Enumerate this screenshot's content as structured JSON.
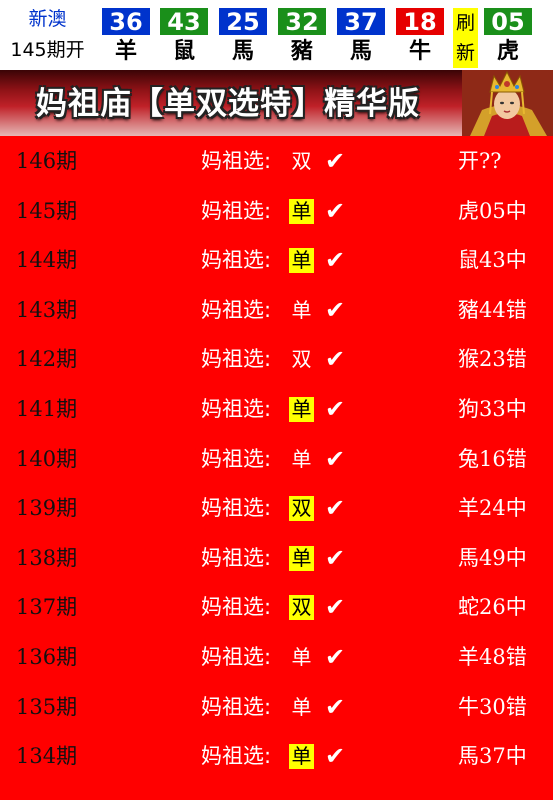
{
  "header": {
    "lottery_name": "新澳",
    "period_label": "145期开",
    "refresh_label": [
      "刷",
      "新"
    ],
    "balls": [
      {
        "number": "36",
        "zodiac": "羊",
        "color": "#0033cc"
      },
      {
        "number": "43",
        "zodiac": "鼠",
        "color": "#1a8f1a"
      },
      {
        "number": "25",
        "zodiac": "馬",
        "color": "#0033cc"
      },
      {
        "number": "32",
        "zodiac": "豬",
        "color": "#1a8f1a"
      },
      {
        "number": "37",
        "zodiac": "馬",
        "color": "#0033cc"
      },
      {
        "number": "18",
        "zodiac": "牛",
        "color": "#e60000"
      },
      {
        "number": "05",
        "zodiac": "虎",
        "color": "#1a8f1a"
      }
    ]
  },
  "banner": {
    "title": "妈祖庙【单双选特】精华版"
  },
  "records": [
    {
      "period": "146期",
      "label": "妈祖选:",
      "pick": "双",
      "highlight": false,
      "tick": "✔",
      "result": "开??"
    },
    {
      "period": "145期",
      "label": "妈祖选:",
      "pick": "单",
      "highlight": true,
      "tick": "✔",
      "result": "虎05中"
    },
    {
      "period": "144期",
      "label": "妈祖选:",
      "pick": "单",
      "highlight": true,
      "tick": "✔",
      "result": "鼠43中"
    },
    {
      "period": "143期",
      "label": "妈祖选:",
      "pick": "单",
      "highlight": false,
      "tick": "✔",
      "result": "豬44错"
    },
    {
      "period": "142期",
      "label": "妈祖选:",
      "pick": "双",
      "highlight": false,
      "tick": "✔",
      "result": "猴23错"
    },
    {
      "period": "141期",
      "label": "妈祖选:",
      "pick": "单",
      "highlight": true,
      "tick": "✔",
      "result": "狗33中"
    },
    {
      "period": "140期",
      "label": "妈祖选:",
      "pick": "单",
      "highlight": false,
      "tick": "✔",
      "result": "兔16错"
    },
    {
      "period": "139期",
      "label": "妈祖选:",
      "pick": "双",
      "highlight": true,
      "tick": "✔",
      "result": "羊24中"
    },
    {
      "period": "138期",
      "label": "妈祖选:",
      "pick": "单",
      "highlight": true,
      "tick": "✔",
      "result": "馬49中"
    },
    {
      "period": "137期",
      "label": "妈祖选:",
      "pick": "双",
      "highlight": true,
      "tick": "✔",
      "result": "蛇26中"
    },
    {
      "period": "136期",
      "label": "妈祖选:",
      "pick": "单",
      "highlight": false,
      "tick": "✔",
      "result": "羊48错"
    },
    {
      "period": "135期",
      "label": "妈祖选:",
      "pick": "单",
      "highlight": false,
      "tick": "✔",
      "result": "牛30错"
    },
    {
      "period": "134期",
      "label": "妈祖选:",
      "pick": "单",
      "highlight": true,
      "tick": "✔",
      "result": "馬37中"
    }
  ]
}
